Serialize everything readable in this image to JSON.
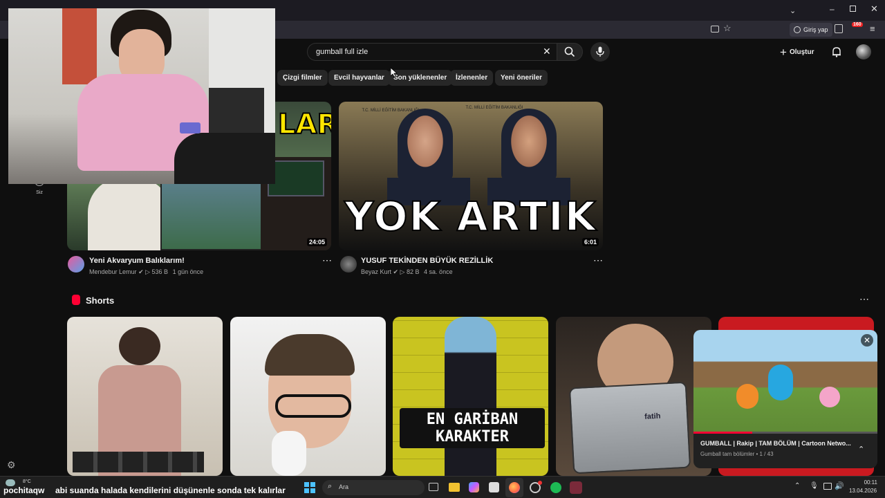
{
  "browser": {
    "signin_label": "Giriş yap",
    "notif_badge": "160"
  },
  "search": {
    "query": "gumball full izle"
  },
  "header": {
    "create_label": "Oluştur"
  },
  "sidebar": {
    "you_label": "Siz"
  },
  "chips": [
    "Çizgi filmler",
    "Evcil hayvanlar",
    "Son yüklenenler",
    "İzlenenler",
    "Yeni öneriler"
  ],
  "videos": [
    {
      "thumb_text": "LAR",
      "duration": "24:05",
      "title": "Yeni Akvaryum Balıklarım!",
      "channel": "Mendebur Lemur",
      "views": "536 B",
      "age": "1 gün önce"
    },
    {
      "thumb_text": "YOK ARTIK",
      "duration": "6:01",
      "title": "YUSUF TEKİNDEN BÜYÜK REZİLLİK",
      "channel": "Beyaz Kurt",
      "views": "82 B",
      "age": "4 sa. önce",
      "badge_left": "T.C. MİLLİ EĞİTİM BAKANLIĞI",
      "badge_right": "T.C. MİLLİ EĞİTİM BAKANLIĞI"
    }
  ],
  "shorts": {
    "section_title": "Shorts",
    "items": [
      {
        "overlay": ""
      },
      {
        "overlay": ""
      },
      {
        "overlay_line1": "EN GARİBAN",
        "overlay_line2": "KARAKTER"
      },
      {
        "overlay": "fatih"
      }
    ]
  },
  "miniplayer": {
    "title": "GUMBALL | Rakip | TAM BÖLÜM | Cartoon Netwo...",
    "subtitle": "Gumball tam bölümler • 1 / 43"
  },
  "ticker": {
    "user": "pochitaqw",
    "message": "abi suanda halada kendilerini düşünenle sonda tek kalırlar"
  },
  "taskbar": {
    "weather_temp": "8°C",
    "search_placeholder": "Ara",
    "time": "00:11",
    "date": "13.04.2026"
  },
  "colors": {
    "accent_red": "#ff0033",
    "bg": "#0f0f0f",
    "chip_bg": "#272727"
  }
}
